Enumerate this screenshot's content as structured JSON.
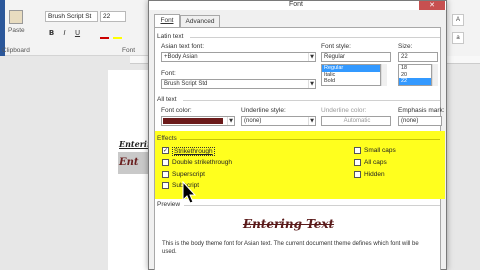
{
  "ribbon": {
    "font_name": "Brush Script St",
    "font_size": "22",
    "paste_label": "Paste",
    "clipboard_label": "Clipboard",
    "font_group_label": "Font",
    "bold": "B",
    "italic": "I",
    "underline": "U"
  },
  "dialog": {
    "title": "Font",
    "close_glyph": "✕",
    "tabs": [
      "Font",
      "Advanced"
    ],
    "latin_text": "Latin text",
    "asian_font_label": "Asian text font:",
    "asian_font_value": "+Body Asian",
    "font_label": "Font:",
    "font_value": "Brush Script Std",
    "font_style_label": "Font style:",
    "font_style_value": "Regular",
    "font_styles": [
      "Regular",
      "Italic",
      "Bold"
    ],
    "size_label": "Size:",
    "size_value": "22",
    "sizes": [
      "18",
      "20",
      "22"
    ],
    "all_text": "All text",
    "font_color_label": "Font color:",
    "font_color": "#6b1a1a",
    "underline_style_label": "Underline style:",
    "underline_style_value": "(none)",
    "underline_color_label": "Underline color:",
    "underline_color_value": "Automatic",
    "emphasis_label": "Emphasis mark:",
    "emphasis_value": "(none)",
    "effects_label": "Effects",
    "effects": {
      "strikethrough": "Strikethrough",
      "double_strikethrough": "Double strikethrough",
      "superscript": "Superscript",
      "subscript": "Subscript",
      "small_caps": "Small caps",
      "all_caps": "All caps",
      "hidden": "Hidden",
      "strikethrough_checked": true
    },
    "preview_label": "Preview",
    "preview_text": "Entering Text",
    "preview_note": "This is the body theme font for Asian text. The current document theme defines which font will be used."
  },
  "document": {
    "text1": "Entering",
    "text2": "Ent"
  }
}
